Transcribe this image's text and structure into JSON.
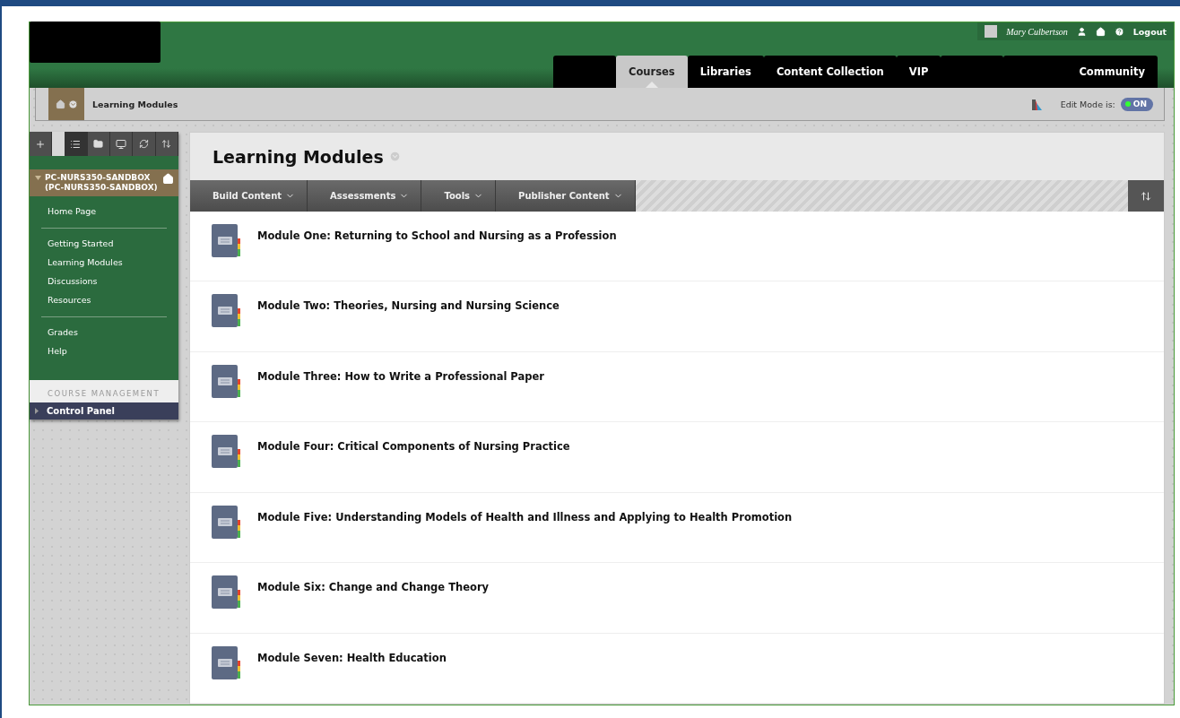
{
  "header": {
    "user_name": "Mary Culbertson",
    "logout": "Logout"
  },
  "tabs": [
    {
      "kind": "blank",
      "selected": false
    },
    {
      "kind": "tab",
      "label": "Courses",
      "selected": true
    },
    {
      "kind": "tab",
      "label": "Libraries",
      "selected": false
    },
    {
      "kind": "tab",
      "label": "Content Collection",
      "selected": false
    },
    {
      "kind": "tab",
      "label": "VIP",
      "selected": false
    },
    {
      "kind": "blank",
      "selected": false
    },
    {
      "kind": "tab",
      "label": "Community",
      "selected": false
    }
  ],
  "breadcrumb": {
    "label": "Learning Modules",
    "edit_mode_label": "Edit Mode is:",
    "edit_mode": {
      "on": true,
      "label": "ON"
    }
  },
  "sidebar": {
    "course_title": "PC-NURS350-SANDBOX (PC-NURS350-SANDBOX)",
    "menu_groups": [
      [
        "Home Page"
      ],
      [
        "Getting Started",
        "Learning Modules",
        "Discussions",
        "Resources"
      ],
      [
        "Grades",
        "Help"
      ]
    ],
    "management_heading": "COURSE MANAGEMENT",
    "control_panel": "Control Panel"
  },
  "content": {
    "title": "Learning Modules",
    "actions": [
      "Build Content",
      "Assessments",
      "Tools",
      "Publisher Content"
    ],
    "modules": [
      {
        "title": "Module One: Returning to School and Nursing as a Profession"
      },
      {
        "title": "Module Two: Theories, Nursing and Nursing Science"
      },
      {
        "title": "Module Three: How to Write a Professional Paper"
      },
      {
        "title": "Module Four: Critical Components of Nursing Practice"
      },
      {
        "title": "Module Five: Understanding Models of Health and Illness and Applying to Health Promotion"
      },
      {
        "title": "Module Six: Change and Change Theory"
      },
      {
        "title": "Module Seven: Health Education"
      }
    ]
  }
}
